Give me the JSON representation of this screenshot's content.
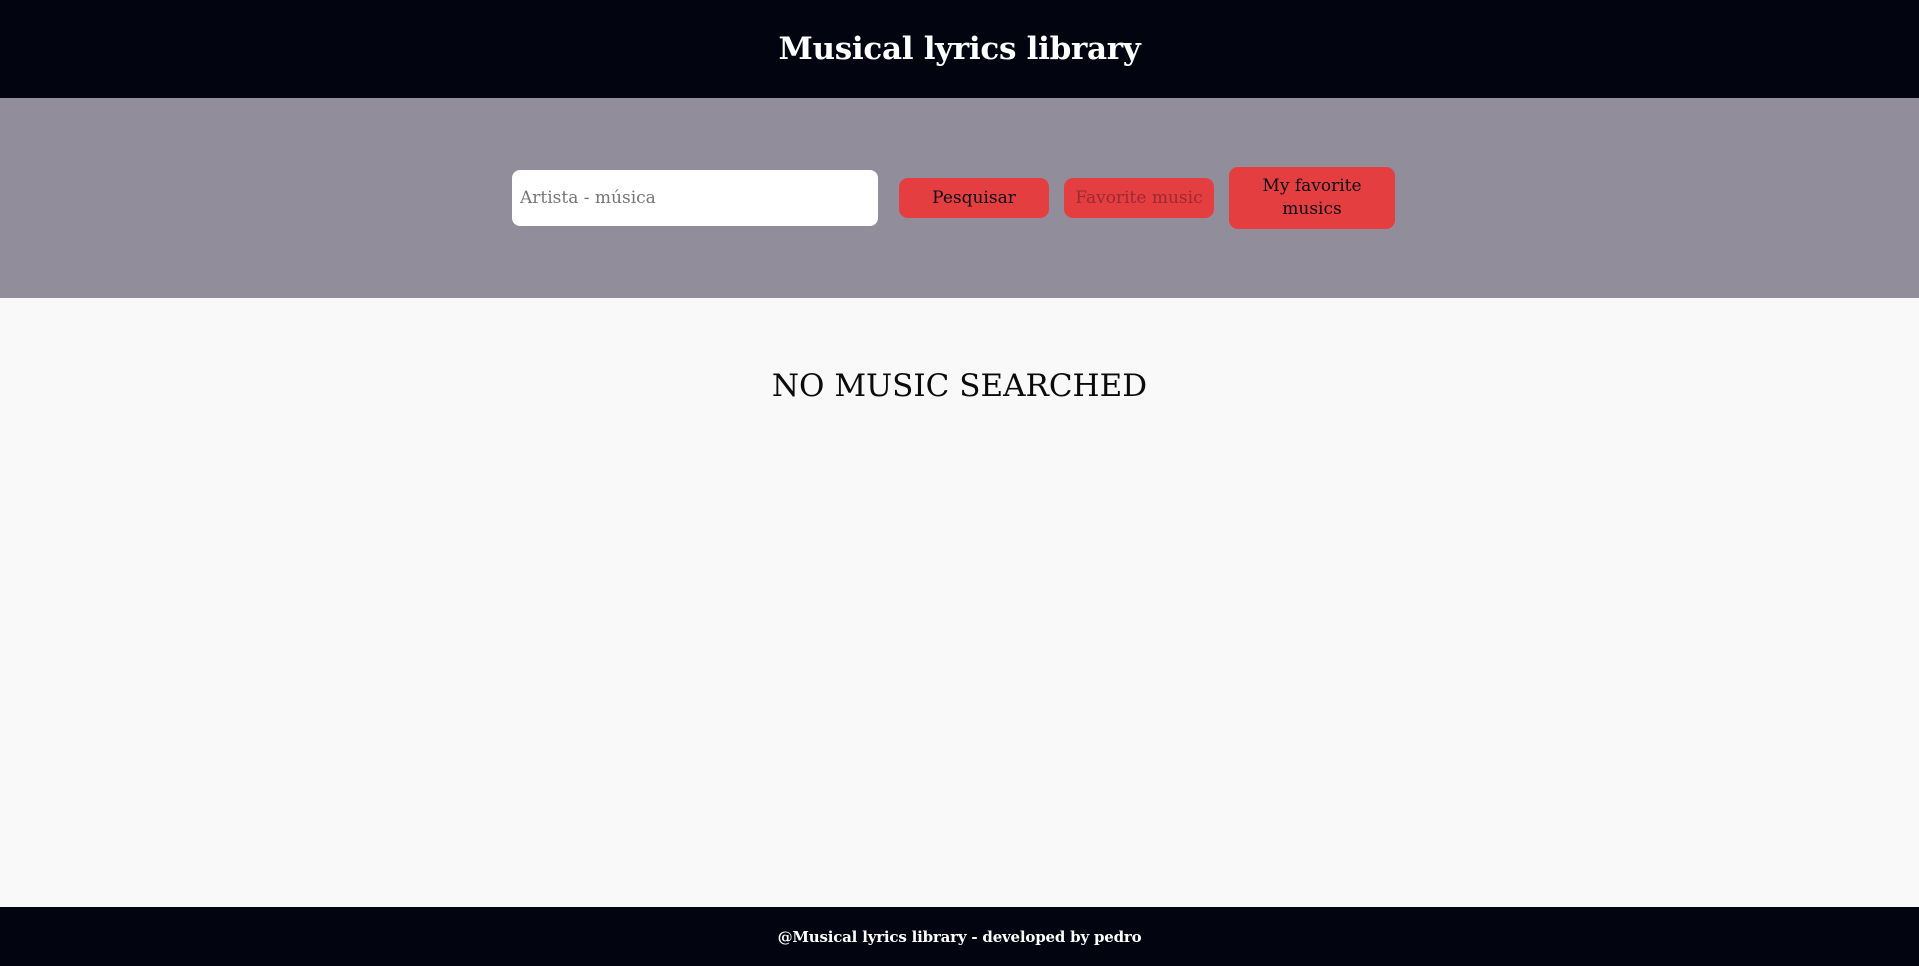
{
  "header": {
    "title": "Musical lyrics library"
  },
  "search": {
    "placeholder": "Artista - música",
    "value": "",
    "search_button_label": "Pesquisar",
    "favorite_button_label": "Favorite music",
    "my_favorites_button_label": "My favorite musics"
  },
  "main": {
    "empty_message": "NO MUSIC SEARCHED"
  },
  "footer": {
    "text": "@Musical lyrics library - developed by pedro"
  },
  "colors": {
    "header_bg": "#020410",
    "search_band_bg": "#918d9b",
    "button_bg": "#e53e41",
    "page_bg": "#f9f9f9"
  }
}
